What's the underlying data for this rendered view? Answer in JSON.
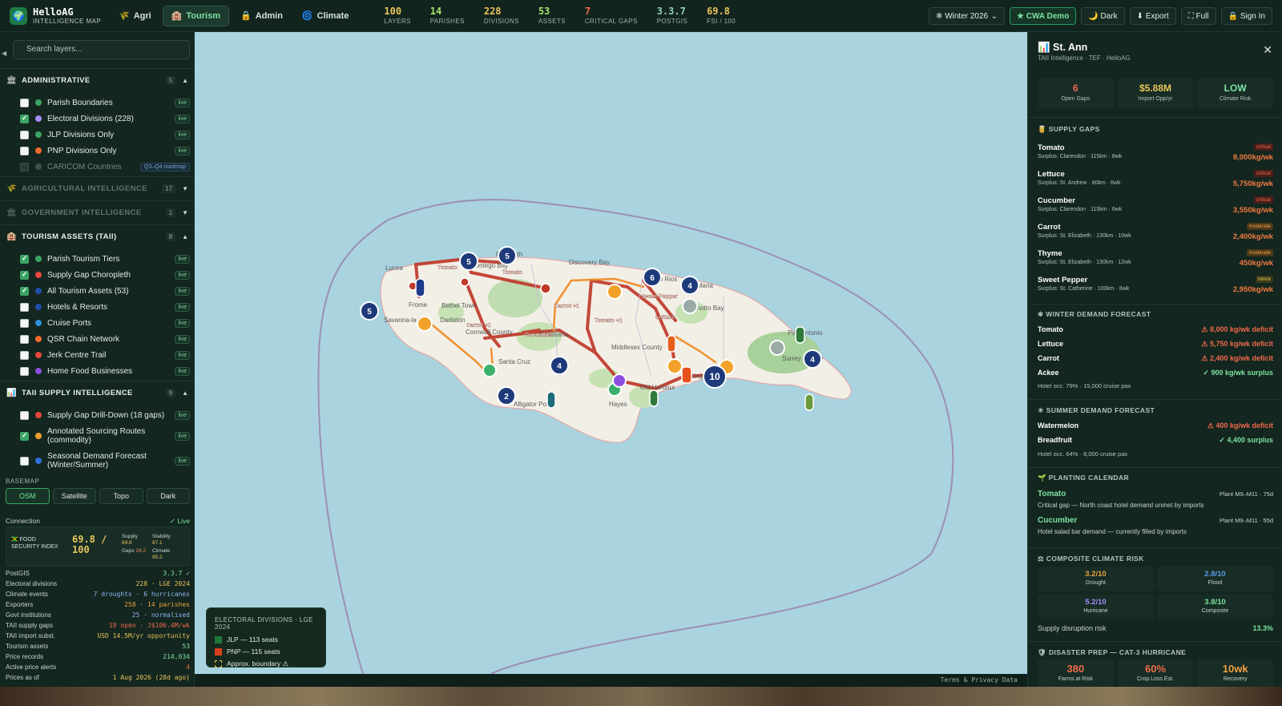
{
  "app": {
    "title": "HelloAG",
    "subtitle": "INTELLIGENCE MAP",
    "logo_icon": "globe-icon"
  },
  "modes": [
    {
      "label": "Agri",
      "icon": "🌾",
      "active": false
    },
    {
      "label": "Tourism",
      "icon": "🏨",
      "active": true
    },
    {
      "label": "Admin",
      "icon": "🔒",
      "active": false
    },
    {
      "label": "Climate",
      "icon": "🌀",
      "active": false
    }
  ],
  "stats": [
    {
      "value": "100",
      "label": "LAYERS",
      "tone": "yellow"
    },
    {
      "value": "14",
      "label": "PARISHES",
      "tone": "green"
    },
    {
      "value": "228",
      "label": "DIVISIONS",
      "tone": "yellow"
    },
    {
      "value": "53",
      "label": "ASSETS",
      "tone": "green"
    },
    {
      "value": "7",
      "label": "CRITICAL GAPS",
      "tone": "red"
    },
    {
      "value": "3.3.7",
      "label": "POSTGIS",
      "tone": "teal"
    },
    {
      "value": "69.8",
      "label": "FSI / 100",
      "tone": "yellow"
    }
  ],
  "header_buttons": {
    "season": "❄ Winter 2026",
    "cwa": "★ CWA Demo",
    "dark": "🌙 Dark",
    "export": "⬇ Export",
    "full": "⛶ Full",
    "signin": "🔒 Sign In"
  },
  "sidebar": {
    "search_placeholder": "Search layers...",
    "sections": [
      {
        "title": "ADMINISTRATIVE",
        "icon": "🏛",
        "count": "5",
        "arrow": "▲",
        "dim": false
      },
      {
        "title": "AGRICULTURAL INTELLIGENCE",
        "icon": "🌾",
        "count": "17",
        "arrow": "▼",
        "dim": true
      },
      {
        "title": "GOVERNMENT INTELLIGENCE",
        "icon": "🏛",
        "count": "1",
        "arrow": "▼",
        "dim": true
      },
      {
        "title": "TOURISM ASSETS (TAII)",
        "icon": "🏨",
        "count": "8",
        "arrow": "▲",
        "dim": false
      },
      {
        "title": "TAII SUPPLY INTELLIGENCE",
        "icon": "📊",
        "count": "9",
        "arrow": "▲",
        "dim": false
      }
    ],
    "admin_items": [
      {
        "label": "Parish Boundaries",
        "checked": false,
        "color": "#3aa564",
        "badge": "live"
      },
      {
        "label": "Electoral Divisions (228)",
        "checked": true,
        "color": "#a78bfa",
        "badge": "live"
      },
      {
        "label": "JLP Divisions Only",
        "checked": false,
        "color": "#3aa564",
        "badge": "live"
      },
      {
        "label": "PNP Divisions Only",
        "checked": false,
        "color": "#ef6a2c",
        "badge": "live"
      },
      {
        "label": "CARICOM Countries",
        "checked": false,
        "color": "#3b5248",
        "badge": "Q3–Q4 roadmap"
      }
    ],
    "tourism_items": [
      {
        "label": "Parish Tourism Tiers",
        "checked": true,
        "color": "#3aa564",
        "badge": "live"
      },
      {
        "label": "Supply Gap Choropleth",
        "checked": true,
        "color": "#e5483a",
        "badge": "live"
      },
      {
        "label": "All Tourism Assets (53)",
        "checked": true,
        "color": "#1f4fa8",
        "badge": "live"
      },
      {
        "label": "Hotels & Resorts",
        "checked": false,
        "color": "#1f4fa8",
        "badge": "live"
      },
      {
        "label": "Cruise Ports",
        "checked": false,
        "color": "#2f8fd8",
        "badge": "live"
      },
      {
        "label": "QSR Chain Network",
        "checked": false,
        "color": "#ef6a2c",
        "badge": "live"
      },
      {
        "label": "Jerk Centre Trail",
        "checked": false,
        "color": "#e5483a",
        "badge": "live"
      },
      {
        "label": "Home Food Businesses",
        "checked": false,
        "color": "#8b4fe0",
        "badge": "live"
      }
    ],
    "supply_items": [
      {
        "label": "Supply Gap Drill-Down (18 gaps)",
        "checked": false,
        "color": "#e5483a",
        "badge": "live"
      },
      {
        "label": "Annotated Sourcing Routes (commodity)",
        "checked": true,
        "color": "#f0a030",
        "badge": "live"
      },
      {
        "label": "Seasonal Demand Forecast (Winter/Summer)",
        "checked": false,
        "color": "#2f6fd8",
        "badge": "live"
      }
    ],
    "basemap_label": "BASEMAP",
    "basemaps": [
      {
        "label": "OSM",
        "active": true
      },
      {
        "label": "Satellite",
        "active": false
      },
      {
        "label": "Topo",
        "active": false
      },
      {
        "label": "Dark",
        "active": false
      }
    ],
    "connection": {
      "label": "Connection",
      "status": "✓ Live"
    },
    "fsi": {
      "label": "🇯🇲 FOOD SECURITY INDEX",
      "value": "69.8 / 100",
      "supply_label": "Supply",
      "supply": "69.8",
      "gaps_label": "Gaps",
      "gaps": "29.2",
      "stability_label": "Stability",
      "stability": "87.1",
      "climate_label": "Climate",
      "climate": "95.2"
    },
    "kv": [
      {
        "k": "PostGIS",
        "v": "3.3.7 ✓",
        "tone": "green"
      },
      {
        "k": "Electoral divisions",
        "v": "228 · LGE 2024",
        "tone": "yellow"
      },
      {
        "k": "Climate events",
        "v": "7 droughts · 6 hurricanes",
        "tone": "blue"
      },
      {
        "k": "Exporters",
        "v": "258 · 14 parishes",
        "tone": "orange"
      },
      {
        "k": "Govt institutions",
        "v": "25 · normalised",
        "tone": "blue"
      },
      {
        "k": "TAII supply gaps",
        "v": "18 open · J$106.4M/wk",
        "tone": "red"
      },
      {
        "k": "TAII import subst.",
        "v": "USD 14.5M/yr opportunity",
        "tone": "yellow"
      },
      {
        "k": "Tourism assets",
        "v": "53",
        "tone": "green"
      },
      {
        "k": "Price records",
        "v": "214,034",
        "tone": "green"
      },
      {
        "k": "Active price alerts",
        "v": "4",
        "tone": "red"
      },
      {
        "k": "Prices as of",
        "v": "1 Aug 2026 (28d ago)",
        "tone": "yellow"
      }
    ]
  },
  "map": {
    "labels": [
      "Montego Bay",
      "Falmouth",
      "Discovery Bay",
      "Ocho Rios",
      "Port Maria",
      "Annotto Bay",
      "Port Antonio",
      "Lucea",
      "Savanna-la-Mar",
      "Frome",
      "Bethel Town",
      "Darliston",
      "Santa Cruz",
      "Christiana",
      "Alligator Pond",
      "Hayes",
      "Old Harbour",
      "Kingston",
      "Middlesex County",
      "Surrey County",
      "Cornwall County"
    ],
    "clusters": [
      "5",
      "5",
      "5",
      "6",
      "4",
      "4",
      "4",
      "2",
      "10"
    ],
    "route_labels": [
      "Tomato",
      "Tomato",
      "Carrot +1",
      "Carrot +1",
      "Cucumber",
      "Tomato +1",
      "Sweet Pepper",
      "Lettuce"
    ],
    "legend": {
      "title": "ELECTORAL DIVISIONS · LGE 2024",
      "rows": [
        {
          "label": "JLP — 113 seats",
          "color": "#1f7a3a"
        },
        {
          "label": "PNP — 115 seats",
          "color": "#d8401c"
        },
        {
          "label": "Approx. boundary ⚠",
          "color": "dashed"
        }
      ]
    },
    "footer": "Terms & Privacy   Data"
  },
  "panel": {
    "title": "📊 St. Ann",
    "subtitle": "TAII Intelligence · TEF · HelloAG",
    "kpis": [
      {
        "value": "6",
        "label": "Open Gaps",
        "color": "#ef6a4c"
      },
      {
        "value": "$5.88M",
        "label": "Import Opp/yr",
        "color": "#e8c35a"
      },
      {
        "value": "LOW",
        "label": "Climate Risk",
        "color": "#7ee2a0"
      }
    ],
    "supply_title": "🥫 SUPPLY GAPS",
    "gaps": [
      {
        "name": "Tomato",
        "surplus": "Surplus: Clarendon · 115km · 8wk",
        "severity": "critical",
        "qty": "8,000kg/wk"
      },
      {
        "name": "Lettuce",
        "surplus": "Surplus: St. Andrew · 80km · 6wk",
        "severity": "critical",
        "qty": "5,750kg/wk"
      },
      {
        "name": "Cucumber",
        "surplus": "Surplus: Clarendon · 115km · 6wk",
        "severity": "critical",
        "qty": "3,550kg/wk"
      },
      {
        "name": "Carrot",
        "surplus": "Surplus: St. Elizabeth · 130km · 10wk",
        "severity": "moderate",
        "qty": "2,400kg/wk"
      },
      {
        "name": "Thyme",
        "surplus": "Surplus: St. Elizabeth · 130km · 12wk",
        "severity": "moderate",
        "qty": "450kg/wk"
      },
      {
        "name": "Sweet Pepper",
        "surplus": "Surplus: St. Catherine · 100km · 8wk",
        "severity": "minor",
        "qty": "2,950kg/wk"
      }
    ],
    "winter_title": "❄ WINTER DEMAND FORECAST",
    "winter": [
      {
        "name": "Tomato",
        "value": "⚠ 8,000 kg/wk deficit",
        "tone": "red"
      },
      {
        "name": "Lettuce",
        "value": "⚠ 5,750 kg/wk deficit",
        "tone": "red"
      },
      {
        "name": "Carrot",
        "value": "⚠ 2,400 kg/wk deficit",
        "tone": "red"
      },
      {
        "name": "Ackee",
        "value": "✓ 900 kg/wk surplus",
        "tone": "green"
      }
    ],
    "winter_note": "Hotel occ. 79% · 15,000 cruise pax",
    "summer_title": "☀ SUMMER DEMAND FORECAST",
    "summer": [
      {
        "name": "Watermelon",
        "value": "⚠ 400 kg/wk deficit",
        "tone": "red"
      },
      {
        "name": "Breadfruit",
        "value": "✓ 4,400 surplus",
        "tone": "green"
      }
    ],
    "summer_note": "Hotel occ. 64% · 8,000 cruise pax",
    "planting_title": "🌱 PLANTING CALENDAR",
    "planting": [
      {
        "name": "Tomato",
        "window": "Plant M9–M11 · 75d",
        "desc": "Critical gap — North coast hotel demand unmet by imports"
      },
      {
        "name": "Cucumber",
        "window": "Plant M9–M11 · 55d",
        "desc": "Hotel salad bar demand — currently filled by imports"
      }
    ],
    "climate_title": "⚖ COMPOSITE CLIMATE RISK",
    "climate": [
      {
        "value": "3.2/10",
        "label": "Drought",
        "color": "#f0a040"
      },
      {
        "value": "2.8/10",
        "label": "Flood",
        "color": "#5a9ae8"
      },
      {
        "value": "5.2/10",
        "label": "Hurricane",
        "color": "#a78bfa"
      },
      {
        "value": "3.8/10",
        "label": "Composite",
        "color": "#7ee2a0"
      }
    ],
    "disruption_label": "Supply disruption risk",
    "disruption_value": "13.3%",
    "disaster_title": "🛡 DISASTER PREP — CAT-3 HURRICANE",
    "disaster": [
      {
        "value": "380",
        "label": "Farms at Risk",
        "color": "#ef6a4c"
      },
      {
        "value": "60%",
        "label": "Crop Loss Est.",
        "color": "#ef6a4c"
      },
      {
        "value": "10wk",
        "label": "Recovery",
        "color": "#f0a040"
      }
    ]
  }
}
